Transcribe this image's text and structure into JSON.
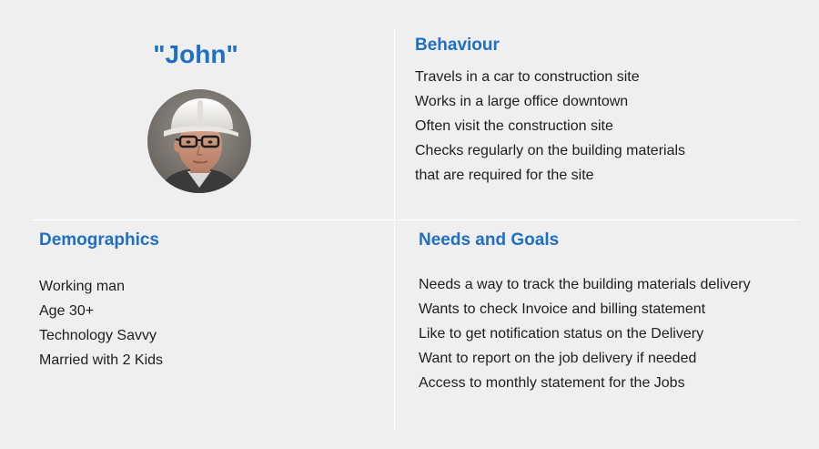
{
  "persona": {
    "name": "\"John\"",
    "colors": {
      "accent": "#1f6fc4",
      "background": "#f0eff0",
      "text": "#1e1e1e",
      "divider": "#ffffff"
    }
  },
  "behaviour": {
    "heading": "Behaviour",
    "items": [
      "Travels in a car to construction site",
      "Works in a large office downtown",
      "Often visit the construction site",
      "Checks regularly on the building materials",
      "that are required for the site"
    ]
  },
  "demographics": {
    "heading": "Demographics",
    "items": [
      "Working man",
      "Age 30+",
      "Technology Savvy",
      "Married with 2 Kids"
    ]
  },
  "needs_goals": {
    "heading": "Needs and Goals",
    "items": [
      "Needs a way to track the building materials delivery",
      "Wants to check Invoice and billing statement",
      "Like to get notification status on the Delivery",
      "Want to report on the job delivery if needed",
      "Access to monthly statement for the Jobs"
    ]
  }
}
